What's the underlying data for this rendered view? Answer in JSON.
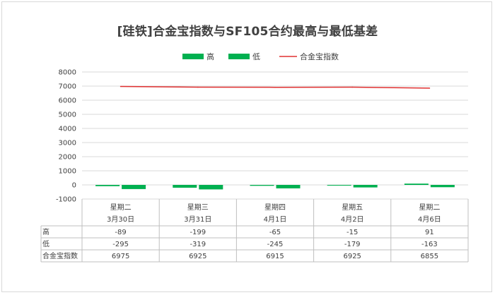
{
  "chart_data": {
    "type": "bar",
    "title": "[硅铁]合金宝指数与SF105合约最高与最低基差",
    "categories": [
      {
        "weekday": "星期二",
        "date": "3月30日"
      },
      {
        "weekday": "星期三",
        "date": "3月31日"
      },
      {
        "weekday": "星期四",
        "date": "4月1日"
      },
      {
        "weekday": "星期五",
        "date": "4月2日"
      },
      {
        "weekday": "星期二",
        "date": "4月6日"
      }
    ],
    "series": [
      {
        "name": "高",
        "kind": "bar",
        "color": "#00b050",
        "values": [
          -89,
          -199,
          -65,
          -15,
          91
        ]
      },
      {
        "name": "低",
        "kind": "bar",
        "color": "#00b050",
        "values": [
          -295,
          -319,
          -245,
          -179,
          -163
        ]
      },
      {
        "name": "合金宝指数",
        "kind": "line",
        "color": "#e03030",
        "values": [
          6975,
          6925,
          6915,
          6925,
          6855
        ]
      }
    ],
    "y_ticks": [
      -1000,
      0,
      1000,
      2000,
      3000,
      4000,
      5000,
      6000,
      7000,
      8000
    ],
    "ylim": [
      -1000,
      8000
    ],
    "grid": true,
    "legend": "top-center",
    "data_table": true
  }
}
